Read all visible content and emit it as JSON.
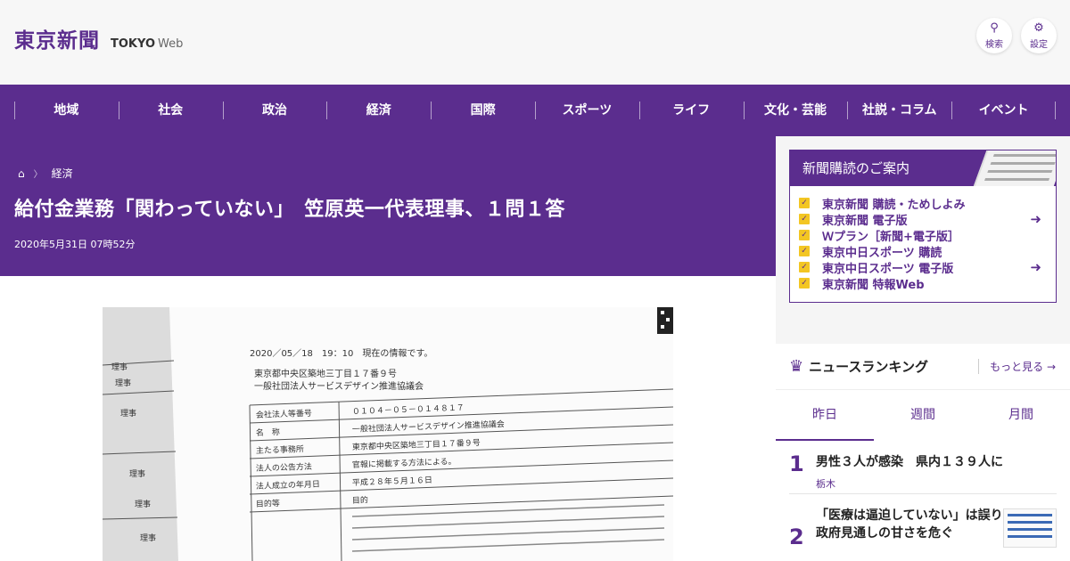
{
  "header": {
    "logo_jp": "東京新聞",
    "logo_en": "TOKYO",
    "logo_web": "Web",
    "search_label": "検索",
    "settings_label": "設定"
  },
  "nav": [
    "地域",
    "社会",
    "政治",
    "経済",
    "国際",
    "スポーツ",
    "ライフ",
    "文化・芸能",
    "社説・コラム",
    "イベント"
  ],
  "article": {
    "breadcrumb": "経済",
    "title": "給付金業務「関わっていない」　笠原英一代表理事、１問１答",
    "date": "2020年5月31日 07時52分"
  },
  "photo": {
    "stamp": "2020／05／18　19：10　現在の情報です。",
    "address_line": "東京都中央区築地三丁目１７番９号",
    "org_line": "一般社団法人サービスデザイン推進協議会",
    "rows": [
      {
        "label": "会社法人等番号",
        "value": "０１０４－０５－０１４８１７"
      },
      {
        "label": "名　称",
        "value": "一般社団法人サービスデザイン推進協議会"
      },
      {
        "label": "主たる事務所",
        "value": "東京都中央区築地三丁目１７番９号"
      },
      {
        "label": "法人の公告方法",
        "value": "官報に掲載する方法による。"
      },
      {
        "label": "法人成立の年月日",
        "value": "平成２８年５月１６日"
      },
      {
        "label": "目的等",
        "value": "目的"
      }
    ],
    "side_labels": [
      "理事",
      "理事",
      "理事",
      "理事",
      "理事",
      "理事"
    ]
  },
  "subscription": {
    "header": "新聞購読のご案内",
    "items": [
      {
        "label": "東京新聞 購読・ためしよみ",
        "login": false
      },
      {
        "label": "東京新聞 電子版",
        "login": true
      },
      {
        "label": "Ｗプラン［新聞+電子版］",
        "login": false
      },
      {
        "label": "東京中日スポーツ 購読",
        "login": false
      },
      {
        "label": "東京中日スポーツ 電子版",
        "login": true
      },
      {
        "label": "東京新聞 特報Web",
        "login": false
      }
    ]
  },
  "ranking": {
    "title": "ニュースランキング",
    "more": "もっと見る",
    "tabs": [
      "昨日",
      "週間",
      "月間"
    ],
    "active_tab": 0,
    "items": [
      {
        "num": "1",
        "text": "男性３人が感染　県内１３９人に",
        "category": "栃木"
      },
      {
        "num": "2",
        "text": "「医療は逼迫していない」は誤り　政府見通しの甘さを危ぐ",
        "category": ""
      }
    ]
  },
  "colors": {
    "brand": "#5b2d8e",
    "accent": "#f3c623"
  }
}
